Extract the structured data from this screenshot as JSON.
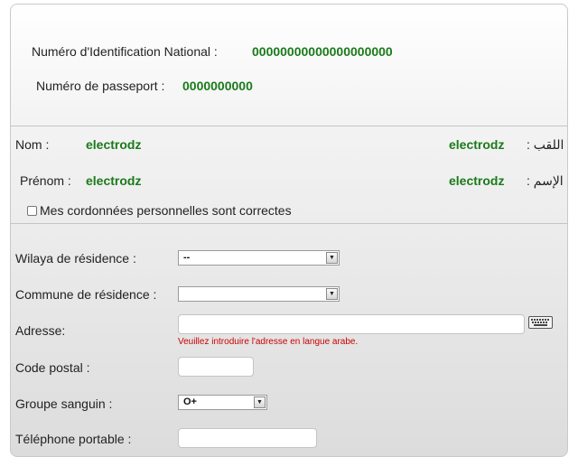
{
  "identity": {
    "nin_label": "Numéro d'Identification National :",
    "nin_value": "00000000000000000000",
    "passport_label": "Numéro de passeport :",
    "passport_value": "0000000000"
  },
  "person": {
    "nom_label": "Nom :",
    "nom_value_fr": "electrodz",
    "nom_value_ar": "electrodz",
    "nom_label_ar": "اللقب  :",
    "prenom_label": "Prénom :",
    "prenom_value_fr": "electrodz",
    "prenom_value_ar": "electrodz",
    "prenom_label_ar": "الإسم  :",
    "confirm_label": "Mes cordonnées personnelles sont correctes",
    "confirm_checked": false
  },
  "form": {
    "wilaya_label": "Wilaya de résidence :",
    "wilaya_value": "--",
    "commune_label": "Commune de résidence :",
    "commune_value": "",
    "address_label": "Adresse:",
    "address_value": "",
    "address_hint": "Veuillez introduire l'adresse en langue arabe.",
    "postal_label": "Code postal :",
    "postal_value": "",
    "blood_label": "Groupe sanguin :",
    "blood_value": "O+",
    "phone_label": "Téléphone portable :",
    "phone_value": ""
  },
  "icons": {
    "dropdown": "chevron-down-icon",
    "keyboard": "keyboard-icon"
  }
}
